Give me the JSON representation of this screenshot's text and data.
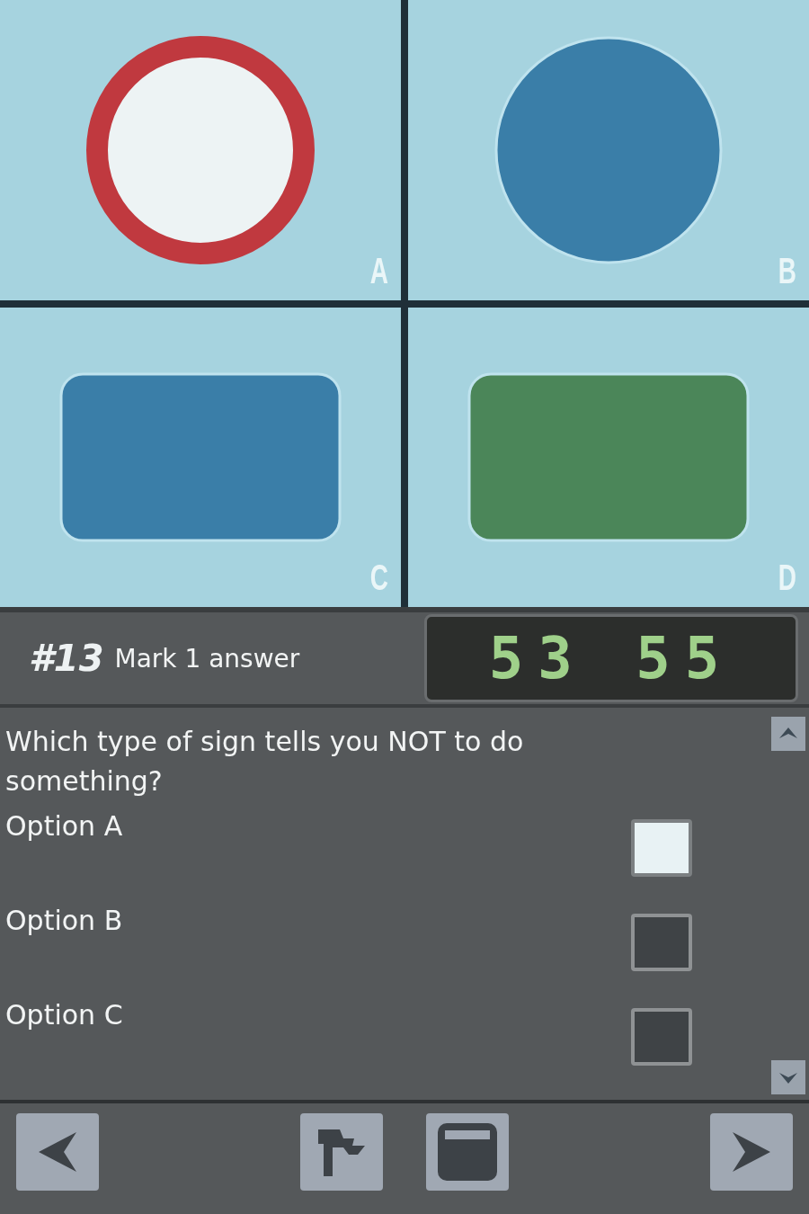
{
  "signs": [
    {
      "kind": "ring",
      "color": "#c0393f",
      "label": "A"
    },
    {
      "kind": "circle",
      "color": "#3a7ea8",
      "label": "B"
    },
    {
      "kind": "rect",
      "color": "#3a7ea8",
      "label": "C"
    },
    {
      "kind": "rect",
      "color": "#4b8659",
      "label": "D"
    }
  ],
  "header": {
    "number": "#13",
    "instruction": "Mark 1 answer",
    "timer": "53 55"
  },
  "question": "Which type of sign tells you NOT to do something?",
  "options": [
    {
      "label": "Option A",
      "checked": true
    },
    {
      "label": "Option B",
      "checked": false
    },
    {
      "label": "Option C",
      "checked": false
    }
  ]
}
